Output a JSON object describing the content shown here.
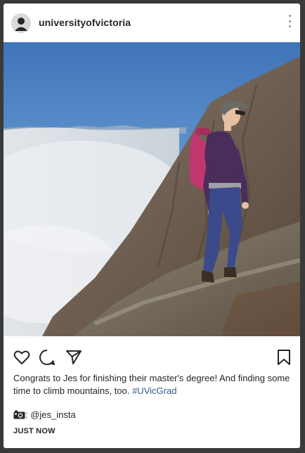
{
  "post": {
    "username": "universityofvictoria",
    "caption_text": " Congrats to Jes for finishing their master's degree! And finding some time to climb mountains, too. ",
    "hashtag": "#UVicGrad",
    "credit_icon": "camera-icon",
    "credit_text": ": @jes_insta",
    "timestamp": "JUST NOW"
  },
  "icons": {
    "avatar": "user-avatar-icon",
    "more": "more-options-icon",
    "like": "heart-icon",
    "comment": "comment-bubble-icon",
    "share": "paper-plane-icon",
    "save": "bookmark-icon"
  },
  "colors": {
    "text": "#262626",
    "hashtag": "#2c5a8c",
    "sky": "#4a86c8",
    "rock": "#7a6a5c",
    "backpack": "#c2366f",
    "jacket": "#4a2d5c",
    "pants": "#3a4a8a"
  }
}
